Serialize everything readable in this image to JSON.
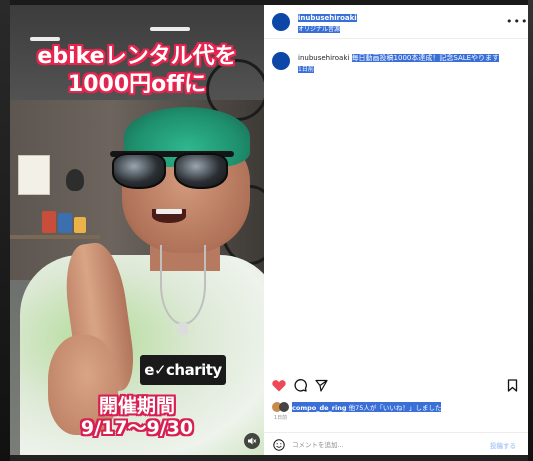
{
  "video": {
    "caption_top_line1": "ebikeレンタル代を",
    "caption_top_line2": "1000円offに",
    "caption_bottom_line1": "開催期間",
    "caption_bottom_line2": "9/17〜9/30",
    "shirt_logo": "e✓charity",
    "caption_color": "#e8244f"
  },
  "header": {
    "username": "inubusehiroaki",
    "subtitle": "オリジナル音源",
    "more_icon": "more-horizontal-icon"
  },
  "post": {
    "username": "inubusehiroaki",
    "caption": "毎日動画投稿1000本達成！記念SALEやります",
    "time": "1日前"
  },
  "actions": {
    "like_icon": "heart-filled-icon",
    "comment_icon": "comment-bubble-icon",
    "share_icon": "send-icon",
    "save_icon": "bookmark-icon",
    "like_color": "#ed4956"
  },
  "likes": {
    "user": "compo_de_ring",
    "rest": "他75人が「いいね！」しました"
  },
  "timestamp": "1日前",
  "comment": {
    "placeholder": "コメントを追加...",
    "post_label": "投稿する",
    "emoji_icon": "emoji-smile-icon"
  },
  "colors": {
    "avatar": "#0c47a8",
    "selection": "#3a6fd8"
  }
}
